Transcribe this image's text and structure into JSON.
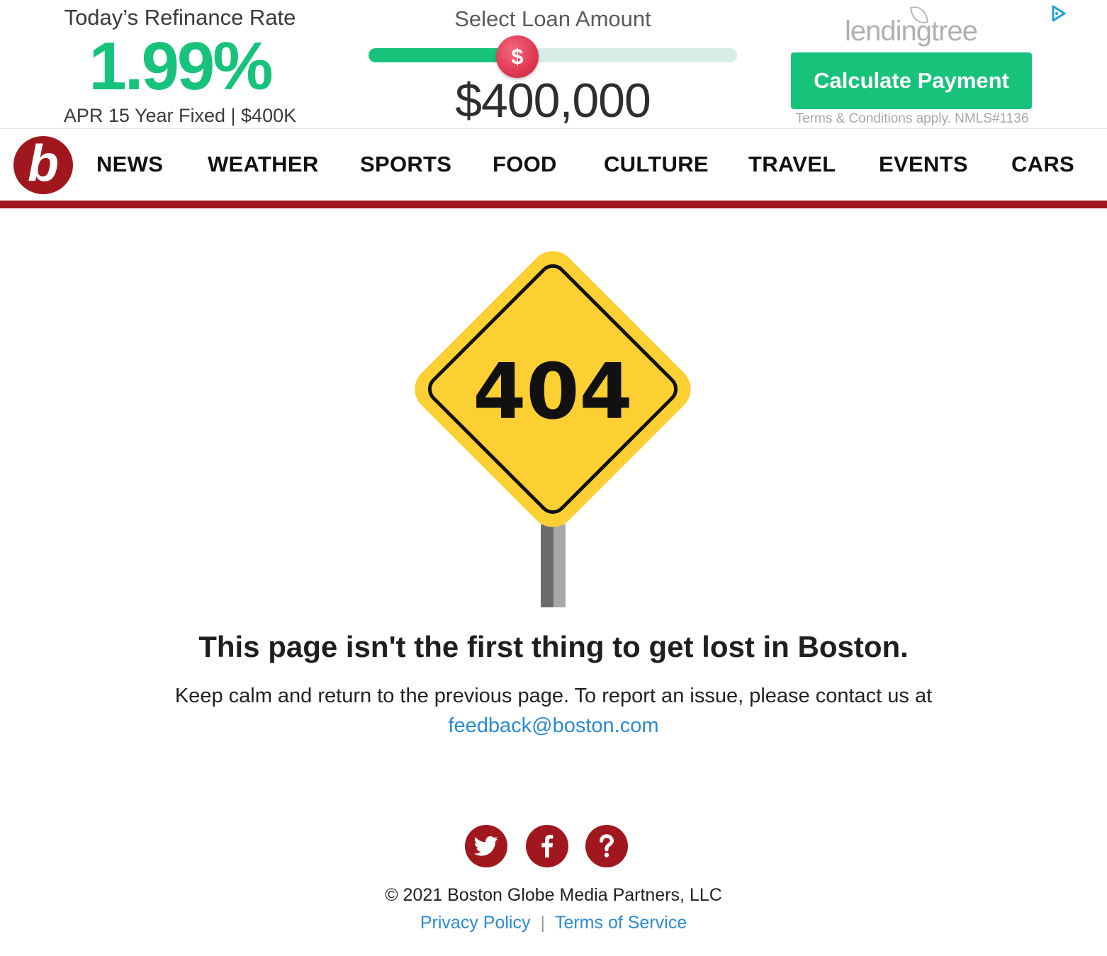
{
  "ad": {
    "rate_title": "Today’s Refinance Rate",
    "rate_value": "1.99%",
    "rate_sub": "APR 15 Year Fixed | $400K",
    "loan_title": "Select Loan Amount",
    "slider_thumb_symbol": "$",
    "slider_fraction": 0.4,
    "loan_amount": "$400,000",
    "brand": "lendingtree",
    "cta_label": "Calculate Payment",
    "terms": "Terms & Conditions apply. NMLS#1136",
    "colors": {
      "green": "#17c37b",
      "thumb": "#e23b55",
      "track": "#d6ece6"
    }
  },
  "nav": {
    "logo_letter": "b",
    "items": [
      "NEWS",
      "WEATHER",
      "SPORTS",
      "FOOD",
      "CULTURE",
      "TRAVEL",
      "EVENTS",
      "CARS"
    ],
    "accent": "#a0181e"
  },
  "error": {
    "code": "404",
    "headline": "This page isn't the first thing to get lost in Boston.",
    "body": "Keep calm and return to the previous page. To report an issue, please contact us at",
    "email": "feedback@boston.com",
    "sign_color": "#fccf33"
  },
  "footer": {
    "social": [
      "twitter-icon",
      "facebook-icon",
      "help-icon"
    ],
    "copyright": "© 2021 Boston Globe Media Partners, LLC",
    "privacy": "Privacy Policy",
    "tos": "Terms of Service",
    "link_color": "#2a8ad4"
  }
}
